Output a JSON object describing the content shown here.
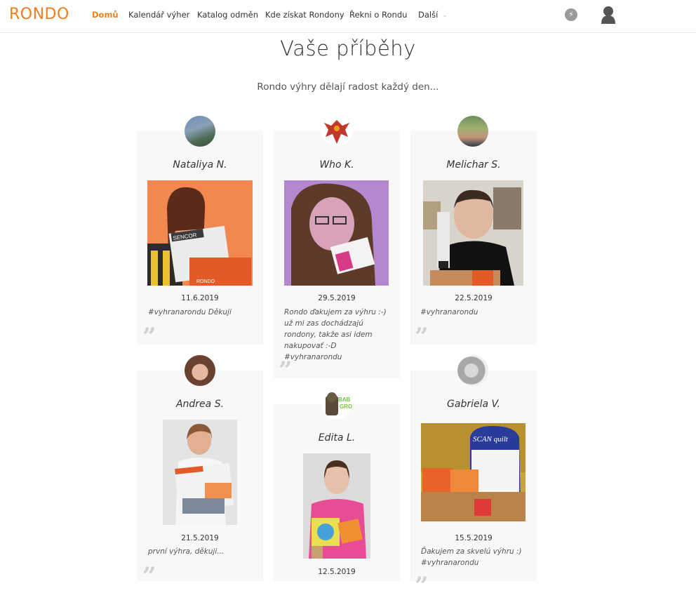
{
  "header": {
    "logo": "RONDO",
    "nav": [
      {
        "label": "Domů"
      },
      {
        "label": "Kalendář výher"
      },
      {
        "label": "Katalog odměn"
      },
      {
        "label": "Kde získat Rondony"
      },
      {
        "label": "Řekni o Rondu"
      },
      {
        "label": "Další"
      }
    ],
    "icons": [
      "lightning-icon",
      "user-icon"
    ],
    "accent": "#f07e1a"
  },
  "page": {
    "title": "Vaše příběhy",
    "subtitle": "Rondo výhry dělají radost každý den..."
  },
  "stories": [
    {
      "name": "Nataliya N.",
      "date": "11.6.2019",
      "text": "#vyhranarondu Děkuji"
    },
    {
      "name": "Who K.",
      "date": "29.5.2019",
      "text": "Rondo ďakujem za výhru :-) už mi zas dochádzajú rondony, takže asi idem nakupovať :-D #vyhranarondu"
    },
    {
      "name": "Melichar S.",
      "date": "22.5.2019",
      "text": "#vyhranarondu"
    },
    {
      "name": "Andrea S.",
      "date": "21.5.2019",
      "text": "první výhra, děkuji..."
    },
    {
      "name": "Edita L.",
      "date": "12.5.2019",
      "text": ""
    },
    {
      "name": "Gabriela V.",
      "date": "15.5.2019",
      "text": "Ďakujem za skvelú výhru :) #vyhranarondu"
    }
  ]
}
